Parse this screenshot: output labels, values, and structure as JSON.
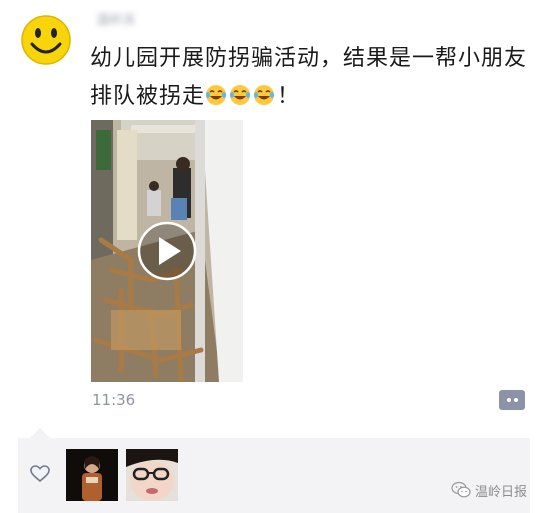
{
  "post": {
    "author_name": "温岭派",
    "text": "幼儿园开展防拐骗活动，结果是一帮小朋友排队被拐走",
    "emojis": [
      "crying-laughing-emoji",
      "crying-laughing-emoji",
      "crying-laughing-emoji"
    ],
    "text_suffix": "！",
    "video": {
      "play_icon": "play-icon"
    },
    "time": "11:36"
  },
  "actions": {
    "comment_icon": "comment-dots-icon"
  },
  "likes": {
    "icon": "heart-outline-icon",
    "likers": [
      "liker-avatar-1",
      "liker-avatar-2"
    ]
  },
  "watermark": {
    "text": "温岭日报",
    "icon": "wechat-icon"
  },
  "colors": {
    "text": "#1a1a1a",
    "timestamp": "#8f94a0",
    "comment_button": "#8d93a6",
    "likes_background": "#f3f3f5"
  }
}
